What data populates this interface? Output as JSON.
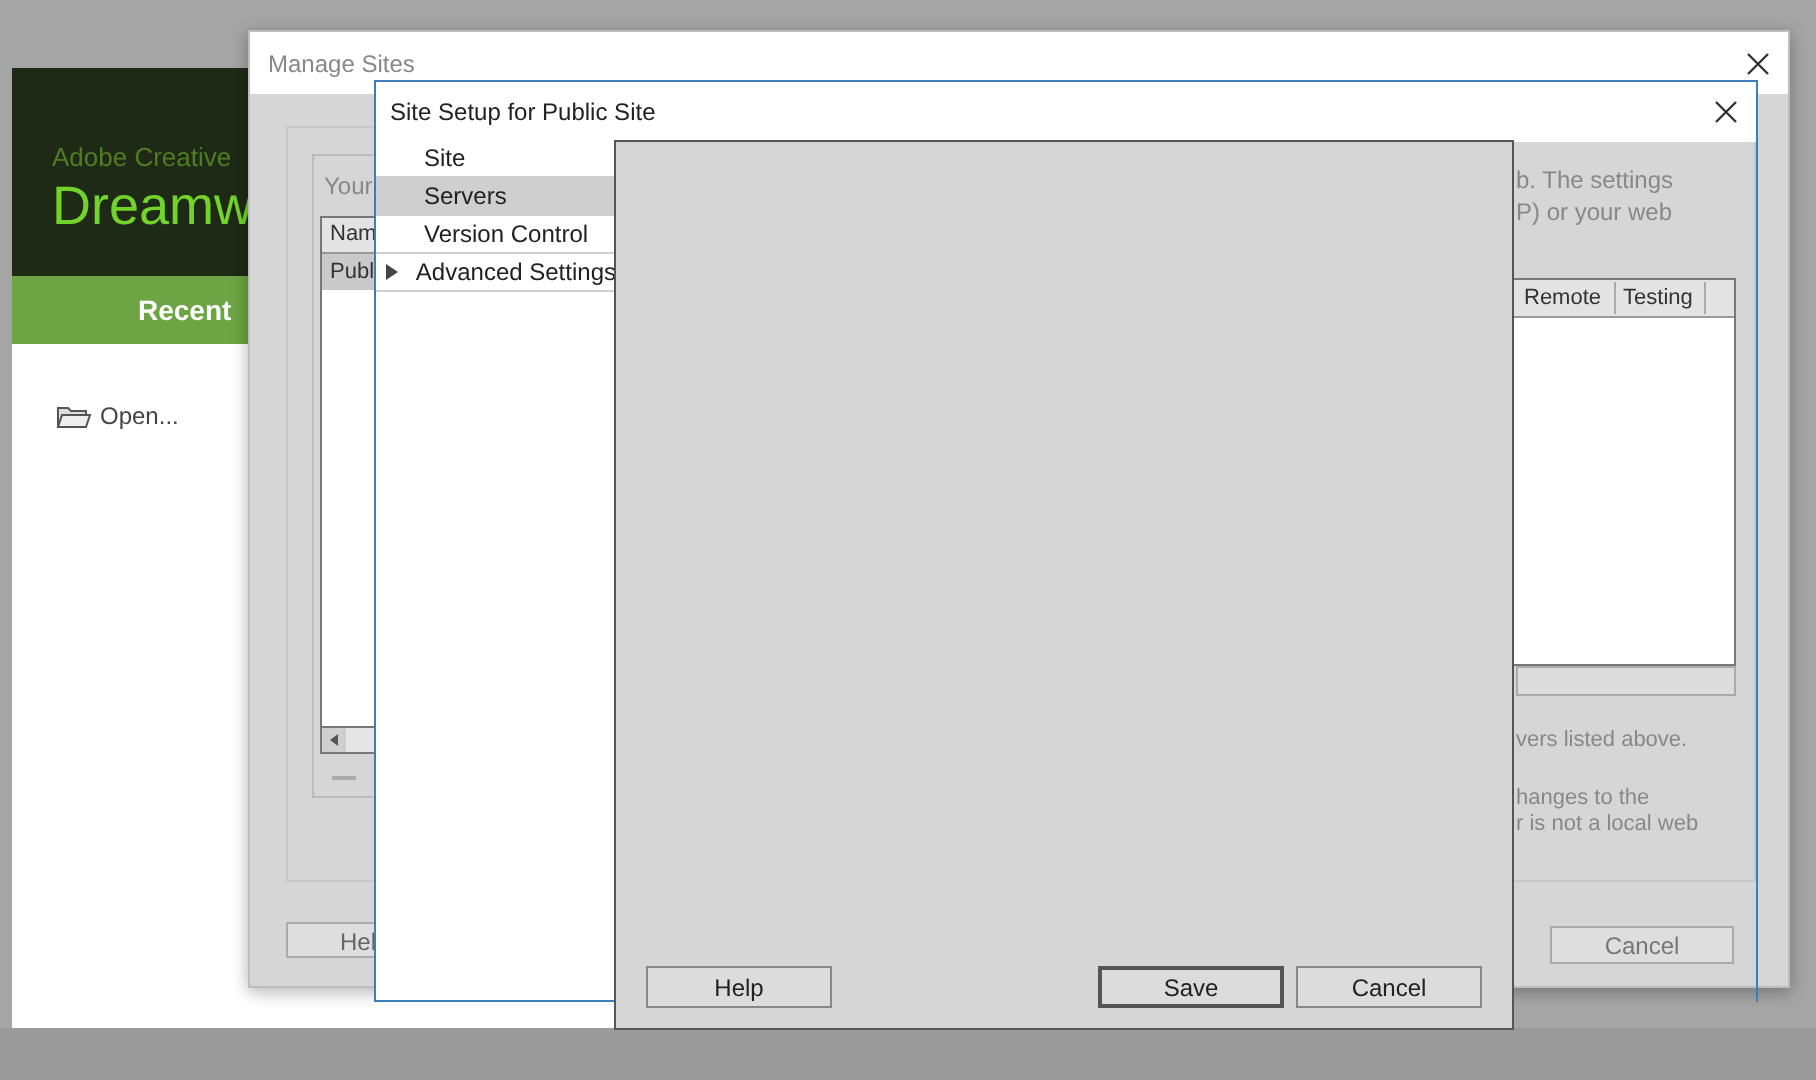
{
  "welcome_window": {
    "brand_line": "Adobe Creative",
    "product_name": "Dreamw",
    "recent_header": "Recent",
    "open_link": "Open..."
  },
  "manage_sites": {
    "title": "Manage Sites",
    "intro_left": "Your",
    "intro_right": [
      "b. The settings",
      "P) or your web"
    ],
    "sites_table": {
      "column": "Nam",
      "rows": [
        {
          "name": "Publ",
          "selected": true
        }
      ]
    },
    "servers_table": {
      "columns": [
        "Remote",
        "Testing"
      ]
    },
    "notes": [
      "vers listed above.",
      "hanges to the",
      "r is not a local web"
    ],
    "help_button": "Hel",
    "cancel_button": "Cancel"
  },
  "site_setup": {
    "title": "Site Setup for Public Site",
    "categories": [
      {
        "label": "Site",
        "kind": "page",
        "selected": false
      },
      {
        "label": "Servers",
        "kind": "page",
        "selected": true
      },
      {
        "label": "Version Control",
        "kind": "page",
        "selected": false
      },
      {
        "label": "Advanced Settings",
        "kind": "group",
        "selected": false
      }
    ],
    "buttons": [
      {
        "label": "Help",
        "default": false
      },
      {
        "label": "Save",
        "default": true
      },
      {
        "label": "Cancel",
        "default": false
      }
    ]
  }
}
